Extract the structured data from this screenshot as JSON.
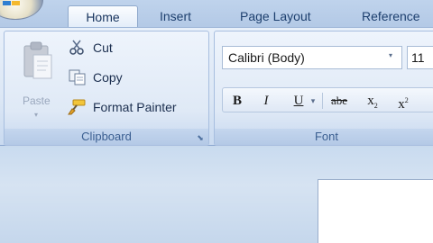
{
  "tabs": [
    {
      "label": "Home",
      "active": true
    },
    {
      "label": "Insert",
      "active": false
    },
    {
      "label": "Page Layout",
      "active": false
    },
    {
      "label": "Reference",
      "active": false
    }
  ],
  "clipboard": {
    "group_label": "Clipboard",
    "paste_label": "Paste",
    "cut_label": "Cut",
    "copy_label": "Copy",
    "format_painter_label": "Format Painter"
  },
  "font": {
    "group_label": "Font",
    "font_name": "Calibri (Body)",
    "font_size": "11",
    "buttons": {
      "bold": "B",
      "italic": "I",
      "underline": "U",
      "strikethrough": "abe",
      "subscript": "x",
      "superscript": "x"
    }
  },
  "colors": {
    "tab_text": "#1d3f6e",
    "group_label_text": "#3a5e90",
    "ribbon_bg": "#dce7f5"
  },
  "icons": {
    "office_button": "office-logo-icon",
    "paste": "clipboard-paste-icon",
    "cut": "scissors-icon",
    "copy": "copy-icon",
    "format_painter": "paintbrush-icon",
    "launcher": "dialog-launcher-icon"
  }
}
